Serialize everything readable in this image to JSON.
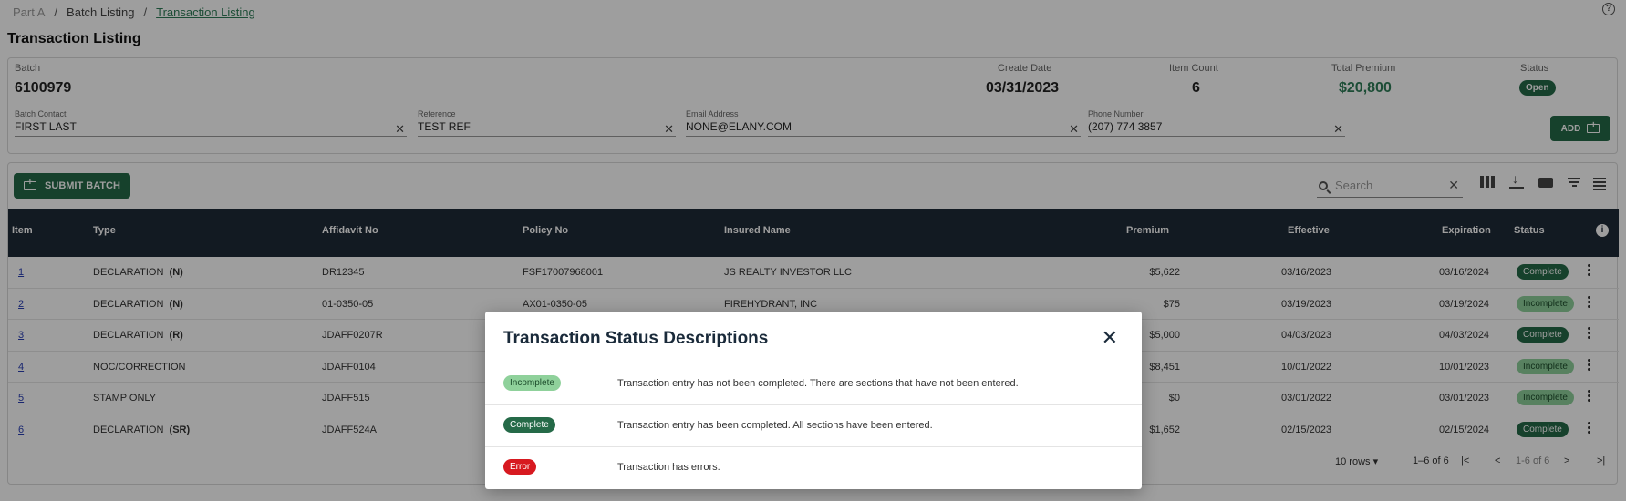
{
  "breadcrumb": {
    "part": "Part A",
    "batch_listing": "Batch Listing",
    "current": "Transaction Listing"
  },
  "page_title": "Transaction Listing",
  "batch": {
    "batch_label": "Batch",
    "batch_value": "6100979",
    "create_date_label": "Create Date",
    "create_date_value": "03/31/2023",
    "item_count_label": "Item Count",
    "item_count_value": "6",
    "total_premium_label": "Total Premium",
    "total_premium_value": "$20,800",
    "status_label": "Status",
    "status_value": "Open"
  },
  "inputs": {
    "batch_contact": {
      "label": "Batch Contact",
      "value": "FIRST LAST"
    },
    "reference": {
      "label": "Reference",
      "value": "TEST REF"
    },
    "email": {
      "label": "Email Address",
      "value": "NONE@ELANY.COM"
    },
    "phone": {
      "label": "Phone Number",
      "value": "(207) 774 3857"
    }
  },
  "add_button": "ADD",
  "submit_button": "SUBMIT BATCH",
  "search_placeholder": "Search",
  "columns": [
    "Item",
    "Type",
    "Affidavit No",
    "Policy No",
    "Insured Name",
    "Premium",
    "Effective",
    "Expiration",
    "Status"
  ],
  "rows": [
    {
      "item": "1",
      "type": "DECLARATION",
      "code": "(N)",
      "affidavit": "DR12345",
      "policy": "FSF17007968001",
      "insured": "JS REALTY INVESTOR LLC",
      "premium": "$5,622",
      "effective": "03/16/2023",
      "expiration": "03/16/2024",
      "status": "Complete"
    },
    {
      "item": "2",
      "type": "DECLARATION",
      "code": "(N)",
      "affidavit": "01-0350-05",
      "policy": "AX01-0350-05",
      "insured": "FIREHYDRANT, INC",
      "premium": "$75",
      "effective": "03/19/2023",
      "expiration": "03/19/2024",
      "status": "Incomplete"
    },
    {
      "item": "3",
      "type": "DECLARATION",
      "code": "(R)",
      "affidavit": "JDAFF0207R",
      "policy": "",
      "insured": "",
      "premium": "$5,000",
      "effective": "04/03/2023",
      "expiration": "04/03/2024",
      "status": "Complete"
    },
    {
      "item": "4",
      "type": "NOC/CORRECTION",
      "code": "",
      "affidavit": "JDAFF0104",
      "policy": "",
      "insured": "",
      "premium": "$8,451",
      "effective": "10/01/2022",
      "expiration": "10/01/2023",
      "status": "Incomplete"
    },
    {
      "item": "5",
      "type": "STAMP ONLY",
      "code": "",
      "affidavit": "JDAFF515",
      "policy": "",
      "insured": "",
      "premium": "$0",
      "effective": "03/01/2022",
      "expiration": "03/01/2023",
      "status": "Incomplete"
    },
    {
      "item": "6",
      "type": "DECLARATION",
      "code": "(SR)",
      "affidavit": "JDAFF524A",
      "policy": "",
      "insured": "",
      "premium": "$1,652",
      "effective": "02/15/2023",
      "expiration": "02/15/2024",
      "status": "Complete"
    }
  ],
  "pager": {
    "rows_per_page": "10 rows",
    "range": "1–6 of 6",
    "range_mid": "1-6 of 6"
  },
  "modal": {
    "title": "Transaction Status Descriptions",
    "items": [
      {
        "badge": "Incomplete",
        "description": "Transaction entry has not been completed. There are sections that have not been entered."
      },
      {
        "badge": "Complete",
        "description": "Transaction entry has been completed. All sections have been entered."
      },
      {
        "badge": "Error",
        "description": "Transaction has errors."
      }
    ]
  },
  "colors": {
    "primary_green": "#256a48",
    "incomplete_green": "#8fd19b",
    "error_red": "#d71920",
    "header_dark": "#1e2a38"
  }
}
